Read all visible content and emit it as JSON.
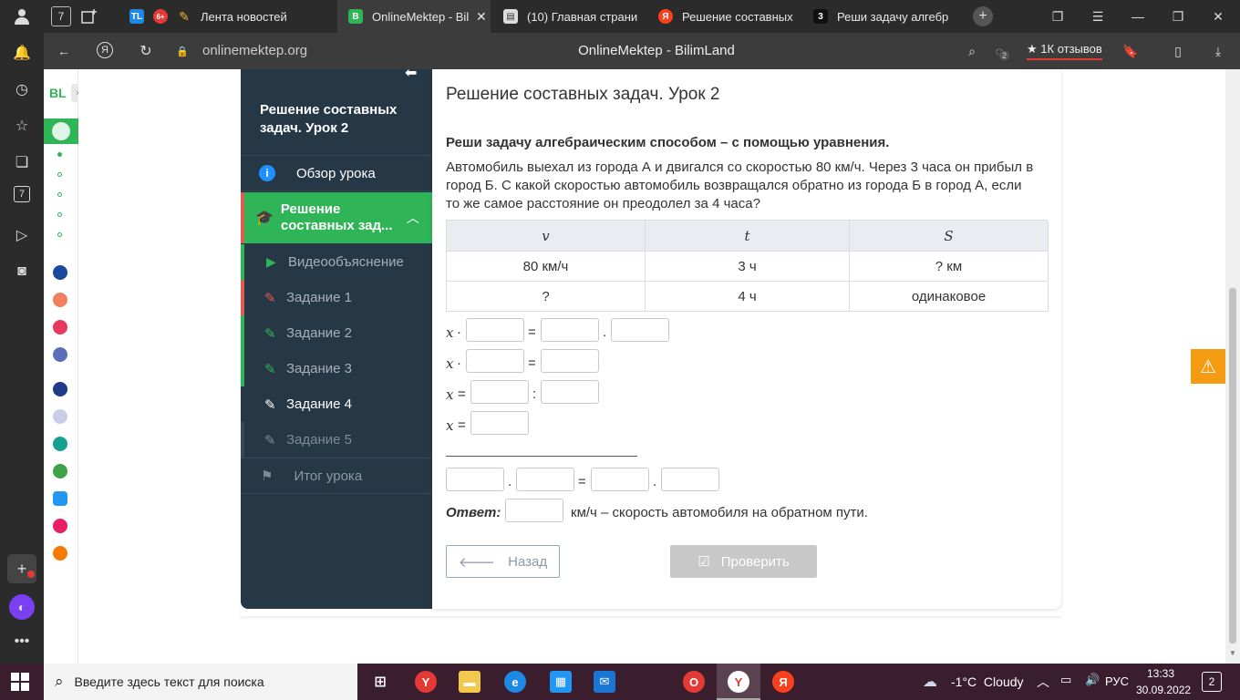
{
  "browser": {
    "tabs": [
      {
        "label": "Лента новостей",
        "favicon": "TL"
      },
      {
        "label": "OnlineMektep - Bil",
        "favicon": "B"
      },
      {
        "label": "(10) Главная страни",
        "favicon": "doc"
      },
      {
        "label": "Решение составных",
        "favicon": "Я"
      },
      {
        "label": "Реши задачу алгебр",
        "favicon": "3"
      }
    ],
    "tab_counter": "7",
    "url": "onlinemektep.org",
    "page_title": "OnlineMektep - BilimLand",
    "reviews": "1К отзывов",
    "badge_count": "2"
  },
  "site": {
    "logo": "BL"
  },
  "lesson_nav": {
    "title": "Решение составных задач. Урок 2",
    "overview": "Обзор урока",
    "section": "Решение составных зад...",
    "items": [
      {
        "label": "Видеообъяснение"
      },
      {
        "label": "Задание 1"
      },
      {
        "label": "Задание 2"
      },
      {
        "label": "Задание 3"
      },
      {
        "label": "Задание 4"
      },
      {
        "label": "Задание 5"
      }
    ],
    "summary": "Итог урока"
  },
  "content": {
    "title": "Решение составных задач. Урок 2",
    "instruction": "Реши задачу алгебраическим способом – с помощью уравнения.",
    "problem": "Автомобиль выехал из города А и двигался со скоростью 80 км/ч. Через 3 часа он прибыл в город Б. С какой скоростью автомобиль возвращался обратно из города Б в город А, если то же самое расстояние он преодолел за 4 часа?",
    "table": {
      "headers": [
        "v",
        "t",
        "S"
      ],
      "rows": [
        [
          "80 км/ч",
          "3 ч",
          "? км"
        ],
        [
          "?",
          "4 ч",
          "одинаковое"
        ]
      ]
    },
    "eq": {
      "x": "x",
      "dot": "·",
      "eq": "=",
      "colon": ":",
      "period": "."
    },
    "answer_label": "Ответ:",
    "answer_suffix": "км/ч – скорость автомобиля на обратном пути.",
    "back_button": "Назад",
    "check_button": "Проверить"
  },
  "taskbar": {
    "search_placeholder": "Введите здесь текст для поиска",
    "weather": "-1°C  Cloudy",
    "lang": "РУС",
    "time": "13:33",
    "date": "30.09.2022",
    "notifications": "2"
  },
  "colors": {
    "green": "#2fb457",
    "nav_bg": "#263746",
    "accent_orange": "#f39c12"
  }
}
